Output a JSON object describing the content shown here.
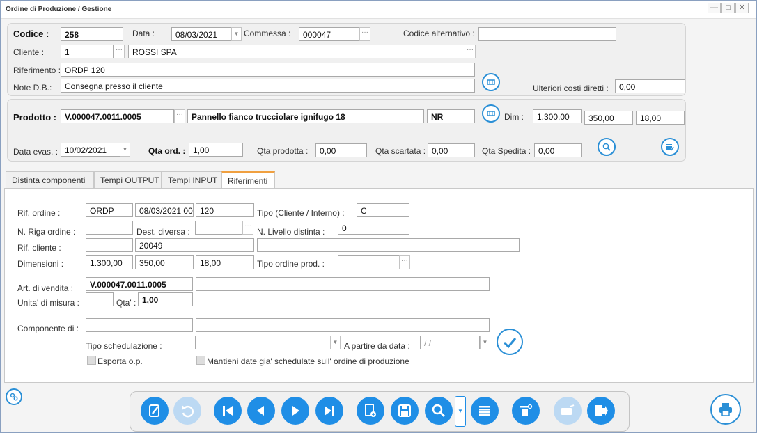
{
  "window": {
    "title": "Ordine di Produzione / Gestione",
    "minimize": "—",
    "maximize": "□",
    "close": "✕"
  },
  "header": {
    "codice_label": "Codice :",
    "codice": "258",
    "data_label": "Data :",
    "data": "08/03/2021",
    "commessa_label": "Commessa :",
    "commessa": "000047",
    "codice_alt_label": "Codice alternativo :",
    "codice_alt": "",
    "cliente_label": "Cliente :",
    "cliente_code": "1",
    "cliente_name": "ROSSI SPA",
    "riferimento_label": "Riferimento :",
    "riferimento": "ORDP 120",
    "note_label": "Note D.B.:",
    "note": "Consegna presso il cliente",
    "costi_label": "Ulteriori costi diretti :",
    "costi": "0,00"
  },
  "product": {
    "prodotto_label": "Prodotto :",
    "prodotto_code": "V.000047.0011.0005",
    "prodotto_desc": "Pannello fianco trucciolare ignifugo 18",
    "um": "NR",
    "dim_label": "Dim :",
    "dim1": "1.300,00",
    "dim2": "350,00",
    "dim3": "18,00",
    "data_evas_label": "Data evas. :",
    "data_evas": "10/02/2021",
    "qta_ord_label": "Qta ord. :",
    "qta_ord": "1,00",
    "qta_prod_label": "Qta prodotta :",
    "qta_prod": "0,00",
    "qta_scart_label": "Qta scartata :",
    "qta_scart": "0,00",
    "qta_sped_label": "Qta Spedita :",
    "qta_sped": "0,00"
  },
  "tabs": [
    {
      "label": "Distinta componenti"
    },
    {
      "label": "Tempi OUTPUT"
    },
    {
      "label": "Tempi INPUT"
    },
    {
      "label": "Riferimenti"
    }
  ],
  "rif": {
    "rif_ordine_label": "Rif. ordine :",
    "rif_ordine_1": "ORDP",
    "rif_ordine_2": "08/03/2021 00",
    "rif_ordine_3": "120",
    "tipo_label": "Tipo (Cliente / Interno) :",
    "tipo": "C",
    "n_riga_label": "N. Riga ordine :",
    "n_riga": "",
    "dest_label": "Dest. diversa :",
    "dest": "",
    "n_livello_label": "N. Livello distinta :",
    "n_livello": "0",
    "rif_cliente_label": "Rif. cliente :",
    "rif_cliente_1": "",
    "rif_cliente_2": "20049",
    "rif_cliente_3": "",
    "dimensioni_label": "Dimensioni :",
    "dim1": "1.300,00",
    "dim2": "350,00",
    "dim3": "18,00",
    "tipo_ord_label": "Tipo ordine prod. :",
    "tipo_ord": "",
    "art_label": "Art. di vendita :",
    "art_code": "V.000047.0011.0005",
    "art_desc": "",
    "um_label": "Unita' di misura :",
    "um": "",
    "qta_label": "Qta' :",
    "qta": "1,00",
    "comp_label": "Componente di :",
    "comp_1": "",
    "comp_2": "",
    "tipo_sched_label": "Tipo schedulazione :",
    "tipo_sched": "",
    "a_partire_label": "A partire da data :",
    "a_partire": "/ /",
    "esporta_label": "Esporta o.p.",
    "mantieni_label": "Mantieni date gia' schedulate sull' ordine di produzione"
  },
  "icons": {
    "accent": "#1f8ee6",
    "toolbar": [
      "edit-icon",
      "undo-icon",
      "first-icon",
      "prev-icon",
      "next-icon",
      "last-icon",
      "new-doc-icon",
      "save-icon",
      "search-icon",
      "list-icon",
      "delete-icon",
      "tag-icon",
      "exit-icon",
      "print-icon"
    ]
  }
}
